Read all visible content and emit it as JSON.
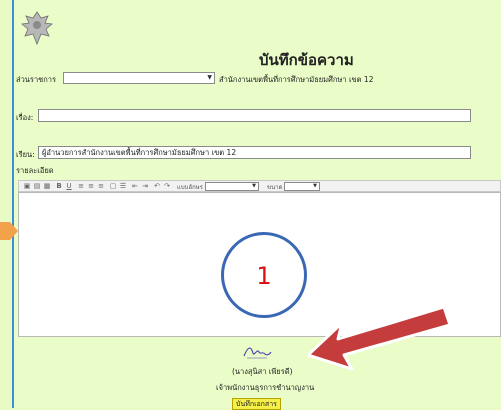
{
  "header": {
    "title": "บันทึกข้อความ",
    "emblem": "garuda-emblem"
  },
  "form": {
    "department_label": "ส่วนราชการ",
    "department_value": "",
    "office_name": "สำนักงานเขตพื้นที่การศึกษามัธยมศึกษา เขต 12",
    "subject_label": "เรื่อง:",
    "subject_value": "",
    "to_label": "เรียน:",
    "to_value": "ผู้อำนวยการสำนักงานเขตพื้นที่การศึกษามัธยมศึกษา เขต 12",
    "detail_label": "รายละเอียด"
  },
  "toolbar": {
    "font_label": "แบบอักษร",
    "size_label": "ขนาด",
    "icons": [
      "source-icon",
      "save-icon",
      "preview-icon",
      "bold-icon",
      "underline-icon",
      "align-left-icon",
      "align-center-icon",
      "align-right-icon",
      "table-icon",
      "list-icon",
      "outdent-icon",
      "indent-icon",
      "undo-icon",
      "redo-icon"
    ]
  },
  "annotation": {
    "step_number": "1",
    "circle_color": "#3a68b4",
    "number_color": "#dd1111",
    "arrow_color": "#c43c3c"
  },
  "signature": {
    "name": "(นางสุนิสา เพียรดี)",
    "position": "เจ้าพนักงานธุรการชำนาญงาน"
  },
  "actions": {
    "save_label": "บันทึกเอกสาร"
  }
}
